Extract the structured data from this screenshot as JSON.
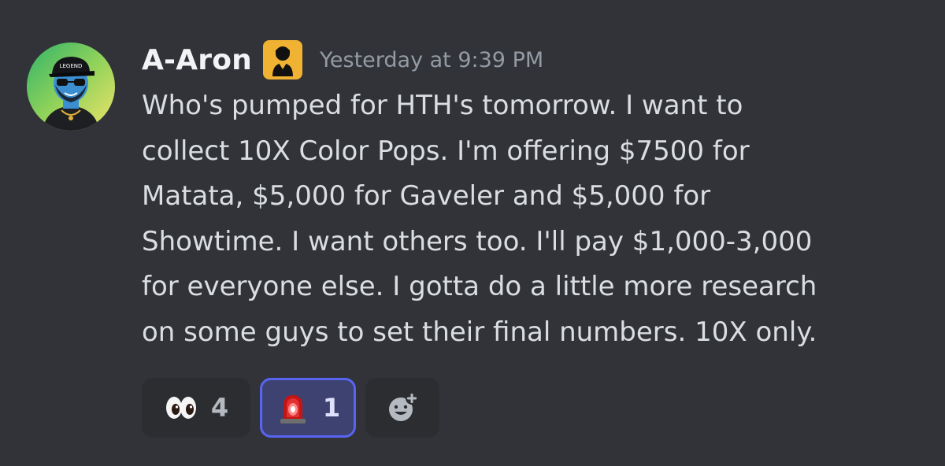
{
  "message": {
    "author": "A-Aron",
    "timestamp": "Yesterday at 9:39 PM",
    "role_icon": "user-badge-icon",
    "content": "Who's pumped for HTH's tomorrow. I want to\ncollect 10X Color Pops. I'm offering $7500 for\nMatata, $5,000 for Gaveler and $5,000 for\nShowtime. I want others too. I'll pay $1,000-3,000\nfor everyone else. I gotta do a little more research\non some guys to set their final numbers. 10X only.",
    "avatar_text": "LEGEND"
  },
  "reactions": [
    {
      "emoji": "eyes-emoji",
      "count": "4",
      "active": false
    },
    {
      "emoji": "siren-emoji",
      "count": "1",
      "active": true
    }
  ],
  "add_reaction": {
    "icon": "add-reaction-icon"
  },
  "colors": {
    "background": "#313338",
    "accent": "#5865f2",
    "role": "#f0b232"
  }
}
